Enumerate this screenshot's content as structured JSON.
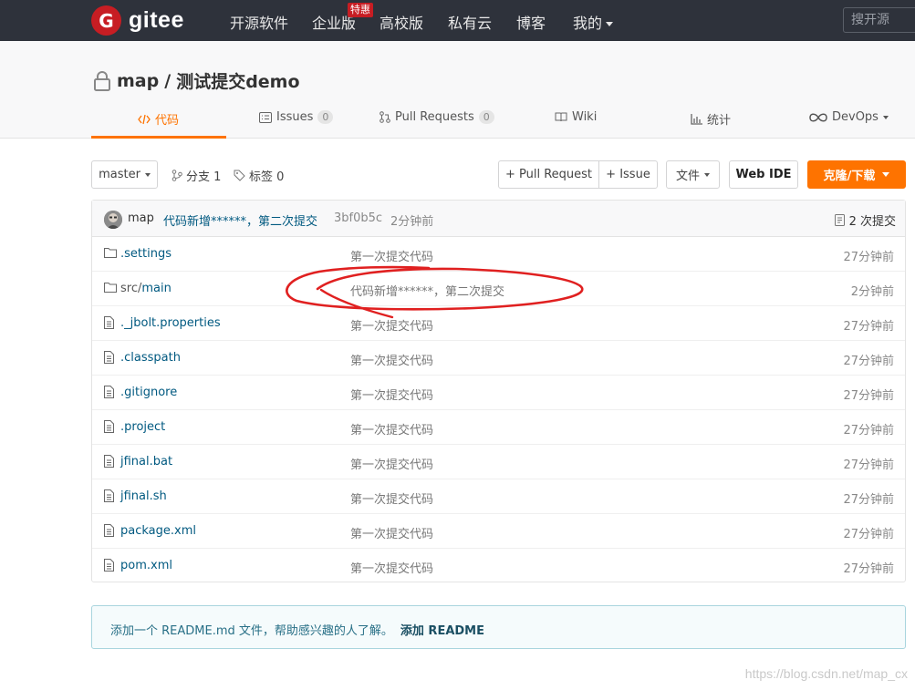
{
  "nav": {
    "logo_mark": "G",
    "logo_text": "gitee",
    "items": [
      "开源软件",
      "企业版",
      "高校版",
      "私有云",
      "博客",
      "我的"
    ],
    "badge": "特惠",
    "search_placeholder": "搜开源"
  },
  "repo": {
    "owner": "map",
    "separator": "/",
    "name": "测试提交demo",
    "tabs": [
      {
        "label": "代码",
        "icon": "code-icon"
      },
      {
        "label": "Issues",
        "count": "0",
        "icon": "issues-icon"
      },
      {
        "label": "Pull Requests",
        "count": "0",
        "icon": "pull-request-icon"
      },
      {
        "label": "Wiki",
        "icon": "wiki-icon"
      },
      {
        "label": "统计",
        "icon": "stats-icon"
      },
      {
        "label": "DevOps",
        "icon": "devops-icon"
      }
    ]
  },
  "toolbar": {
    "branch": "master",
    "branches": "分支 1",
    "tags": "标签 0",
    "pull_request": "+ Pull Request",
    "issue": "+ Issue",
    "file": "文件",
    "web_ide": "Web IDE",
    "clone": "克隆/下载"
  },
  "commit": {
    "author": "map",
    "message": "代码新增******，第二次提交",
    "sha": "3bf0b5c",
    "time": "2分钟前",
    "count": "2 次提交"
  },
  "files": [
    {
      "name": ".settings",
      "type": "folder",
      "message": "第一次提交代码",
      "time": "27分钟前"
    },
    {
      "name_prefix": "src/",
      "name": "main",
      "type": "folder",
      "message": "代码新增******，第二次提交",
      "time": "2分钟前"
    },
    {
      "name": "._jbolt.properties",
      "type": "file",
      "message": "第一次提交代码",
      "time": "27分钟前"
    },
    {
      "name": ".classpath",
      "type": "file",
      "message": "第一次提交代码",
      "time": "27分钟前"
    },
    {
      "name": ".gitignore",
      "type": "file",
      "message": "第一次提交代码",
      "time": "27分钟前"
    },
    {
      "name": ".project",
      "type": "file",
      "message": "第一次提交代码",
      "time": "27分钟前"
    },
    {
      "name": "jfinal.bat",
      "type": "file",
      "message": "第一次提交代码",
      "time": "27分钟前"
    },
    {
      "name": "jfinal.sh",
      "type": "file",
      "message": "第一次提交代码",
      "time": "27分钟前"
    },
    {
      "name": "package.xml",
      "type": "file",
      "message": "第一次提交代码",
      "time": "27分钟前"
    },
    {
      "name": "pom.xml",
      "type": "file",
      "message": "第一次提交代码",
      "time": "27分钟前"
    }
  ],
  "readme": {
    "text": "添加一个 README.md 文件，帮助感兴趣的人了解。",
    "link": "添加 README"
  },
  "watermark": "https://blog.csdn.net/map_cx",
  "colors": {
    "nav_bg": "#2e323b",
    "accent": "#fe7300",
    "brand_red": "#c71d23",
    "link": "#005980",
    "annotation": "#e02020"
  }
}
